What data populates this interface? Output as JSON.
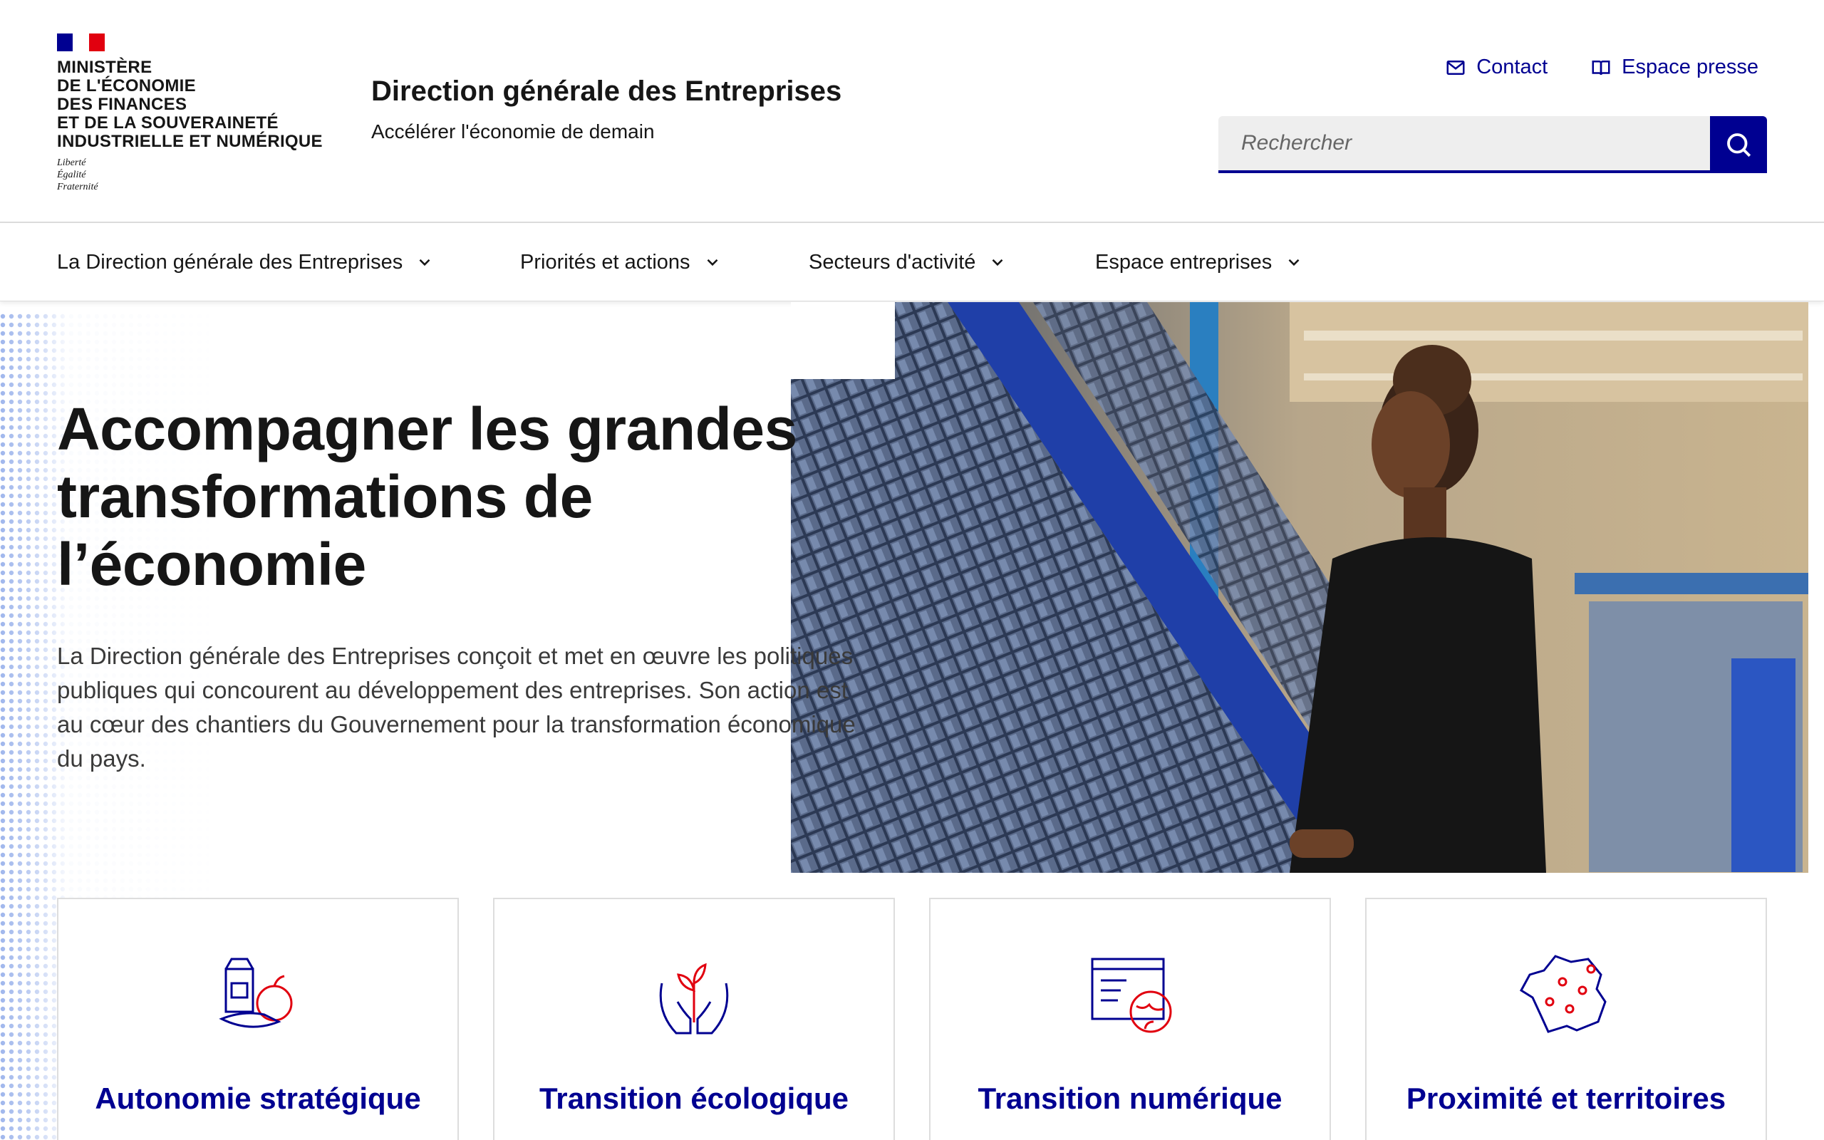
{
  "header": {
    "ministry_lines": [
      "MINISTÈRE",
      "DE L'ÉCONOMIE",
      "DES FINANCES",
      "ET DE LA SOUVERAINETÉ",
      "INDUSTRIELLE ET NUMÉRIQUE"
    ],
    "motto_lines": [
      "Liberté",
      "Égalité",
      "Fraternité"
    ],
    "service_title": "Direction générale des Entreprises",
    "service_tagline": "Accélérer l'économie de demain",
    "tools": [
      {
        "label": "Contact",
        "icon": "mail-icon"
      },
      {
        "label": "Espace presse",
        "icon": "book-icon"
      }
    ],
    "search": {
      "placeholder": "Rechercher",
      "button_icon": "search-icon"
    }
  },
  "nav": {
    "items": [
      {
        "label": "La Direction générale des Entreprises"
      },
      {
        "label": "Priorités et actions"
      },
      {
        "label": "Secteurs d'activité"
      },
      {
        "label": "Espace entreprises"
      }
    ]
  },
  "hero": {
    "title": "Accompagner les grandes transformations de l’économie",
    "text": "La Direction générale des Entreprises conçoit et met en œuvre les politiques publiques qui concourent au développement des entreprises. Son action est au cœur des chantiers du Gouvernement pour la transformation économique du pays."
  },
  "cards": [
    {
      "title": "Autonomie stratégique",
      "icon": "food-autonomy-icon"
    },
    {
      "title": "Transition écologique",
      "icon": "plant-hands-icon"
    },
    {
      "title": "Transition numérique",
      "icon": "digital-globe-icon"
    },
    {
      "title": "Proximité et territoires",
      "icon": "france-map-icon"
    }
  ],
  "colors": {
    "primary": "#000091",
    "accent_red": "#e1000f",
    "text": "#161616"
  }
}
